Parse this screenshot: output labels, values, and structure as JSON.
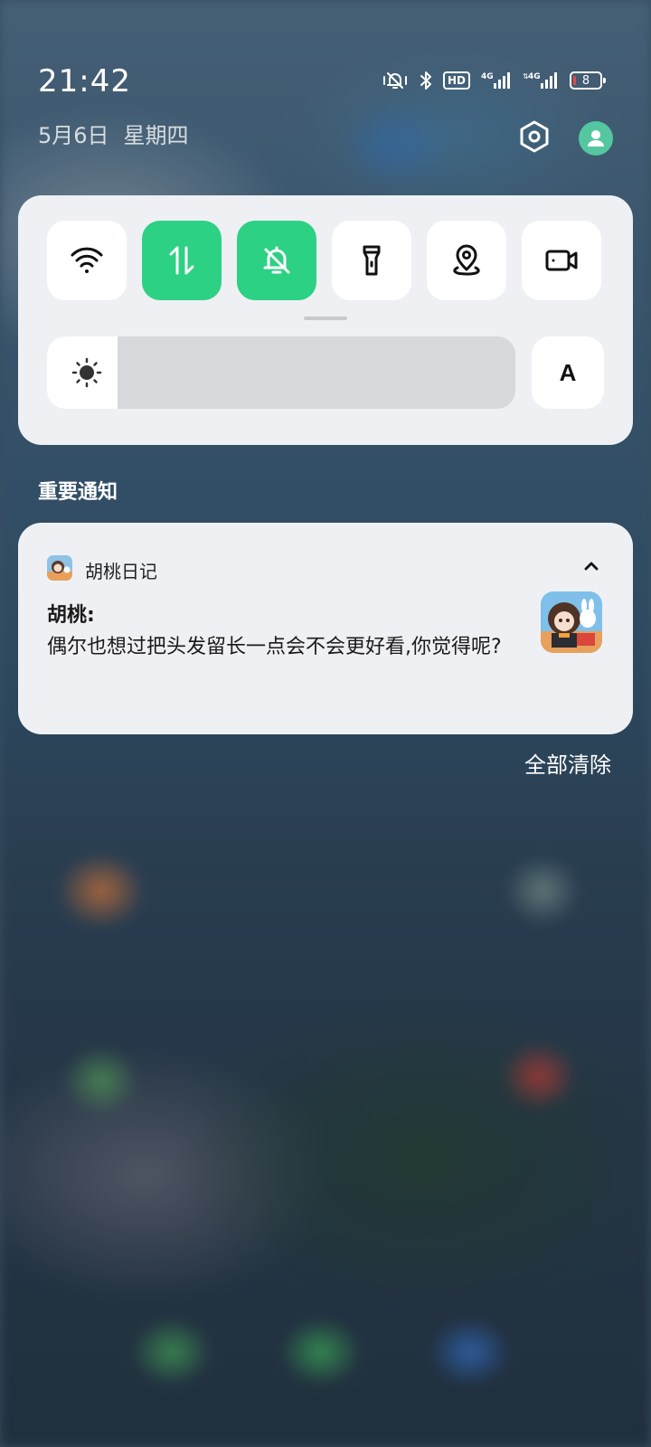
{
  "status_bar": {
    "time": "21:42",
    "date": "5月6日",
    "weekday": "星期四",
    "network_badge": "HD",
    "sim1": "4G",
    "sim2": "4G",
    "battery_level": "8",
    "icons": [
      "mute-vibrate-icon",
      "bluetooth-icon",
      "hd-icon",
      "signal-4g-icon",
      "signal-4g-icon",
      "battery-icon"
    ]
  },
  "header_actions": {
    "settings_icon": "settings-hexagon-icon",
    "account_icon": "user-avatar-icon"
  },
  "quick_settings": {
    "tiles": [
      {
        "name": "wifi",
        "icon": "wifi-icon",
        "active": false
      },
      {
        "name": "mobile-data",
        "icon": "data-transfer-icon",
        "active": true
      },
      {
        "name": "do-not-disturb",
        "icon": "bell-off-icon",
        "active": true
      },
      {
        "name": "flashlight",
        "icon": "flashlight-icon",
        "active": false
      },
      {
        "name": "location",
        "icon": "location-icon",
        "active": false
      },
      {
        "name": "screen-record",
        "icon": "video-camera-icon",
        "active": false
      }
    ],
    "brightness_level": 0.15,
    "auto_brightness_label": "A",
    "accent_color": "#2dd184"
  },
  "notifications": {
    "section_title": "重要通知",
    "items": [
      {
        "app_name": "胡桃日记",
        "title": "胡桃:",
        "body": "偶尔也想过把头发留长一点会不会更好看,你觉得呢?"
      }
    ],
    "clear_all_label": "全部清除"
  }
}
